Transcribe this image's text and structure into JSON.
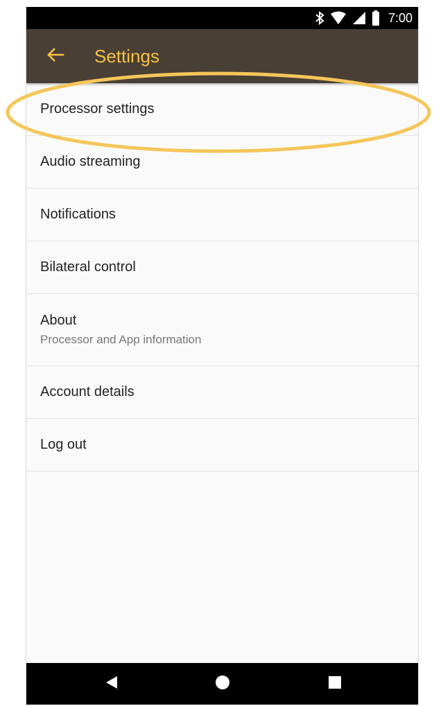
{
  "status_bar": {
    "time": "7:00",
    "icons": [
      "bluetooth-icon",
      "wifi-icon",
      "cellular-signal-icon",
      "battery-icon"
    ]
  },
  "app_bar": {
    "title": "Settings",
    "back_icon": "arrow-back-icon"
  },
  "settings": {
    "items": [
      {
        "title": "Processor settings"
      },
      {
        "title": "Audio streaming"
      },
      {
        "title": "Notifications"
      },
      {
        "title": "Bilateral control"
      },
      {
        "title": "About",
        "subtitle": "Processor and App information"
      },
      {
        "title": "Account details"
      },
      {
        "title": "Log out"
      }
    ]
  },
  "annotation": {
    "highlighted_item": "Processor settings",
    "color": "#f5c65a"
  },
  "nav_bar": {
    "icons": [
      "back-triangle-icon",
      "home-circle-icon",
      "recents-square-icon"
    ]
  },
  "colors": {
    "app_bar_bg": "#4a3f35",
    "accent": "#f5c242",
    "status_bar_bg": "#000000",
    "nav_bar_bg": "#000000",
    "list_bg": "#fafafa"
  }
}
